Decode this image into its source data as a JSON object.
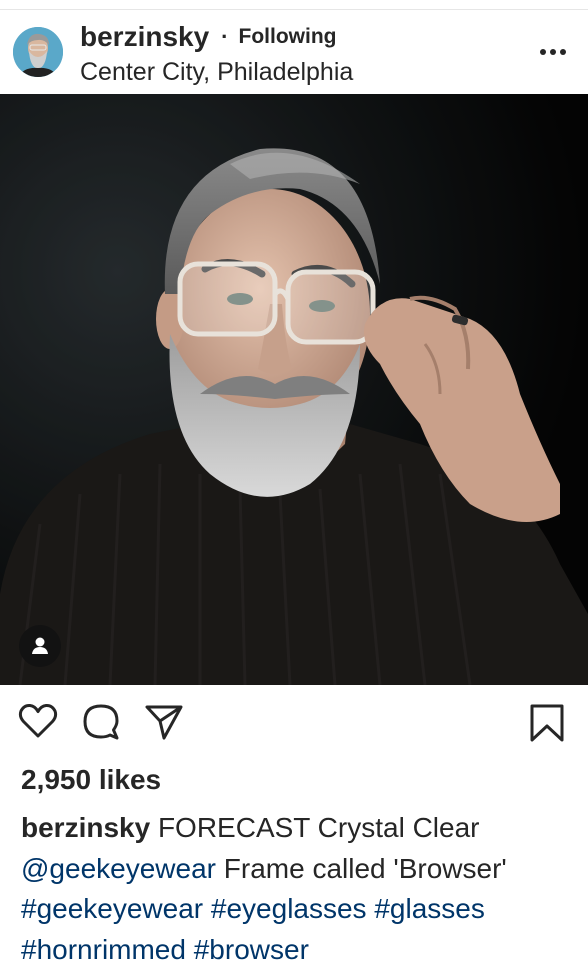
{
  "header": {
    "username": "berzinsky",
    "separator": "·",
    "follow_state": "Following",
    "location": "Center City, Philadelphia",
    "more_icon": "more-horizontal-icon",
    "avatar_icon": "profile-photo"
  },
  "photo": {
    "tag_icon": "user-tag-icon"
  },
  "actions": {
    "like_icon": "heart-icon",
    "comment_icon": "comment-icon",
    "share_icon": "paper-plane-icon",
    "save_icon": "bookmark-icon"
  },
  "likes": "2,950 likes",
  "caption": {
    "username": "berzinsky",
    "text": "FORECAST Crystal Clear",
    "mention": "@geekeyewear",
    "mention_text": "Frame called 'Browser'",
    "hashtags_line1": [
      "#geekeyewear",
      "#eyeglasses",
      "#glasses"
    ],
    "hashtags_line2": [
      "#hornrimmed",
      "#browser"
    ]
  },
  "colors": {
    "text": "#262626",
    "link": "#003569",
    "background": "#ffffff"
  }
}
